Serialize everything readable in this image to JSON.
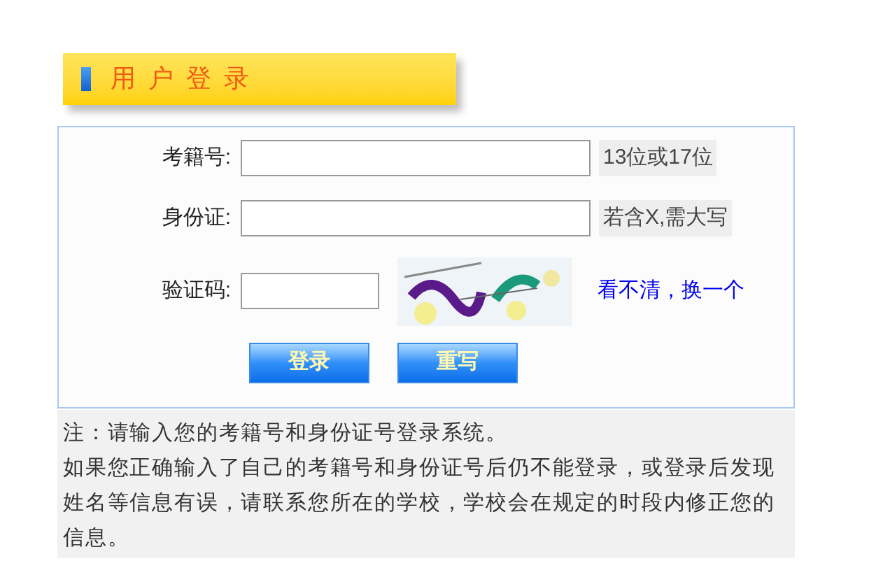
{
  "header": {
    "title": "用 户 登 录"
  },
  "fields": [
    {
      "label": "考籍号:",
      "hint": "13位或17位"
    },
    {
      "label": "身份证:",
      "hint": "若含X,需大写"
    }
  ],
  "captcha": {
    "label": "验证码:",
    "refresh_link": "看不清，换一个",
    "kind": "picture"
  },
  "buttons": [
    "登录",
    "重写"
  ],
  "notes": [
    "注：请输入您的考籍号和身份证号登录系统。",
    "如果您正确输入了自己的考籍号和身份证号后仍不能登录，或登录后发现姓名等信息有误，请联系您所在的学校，学校会在规定的时段内修正您的信息。"
  ]
}
